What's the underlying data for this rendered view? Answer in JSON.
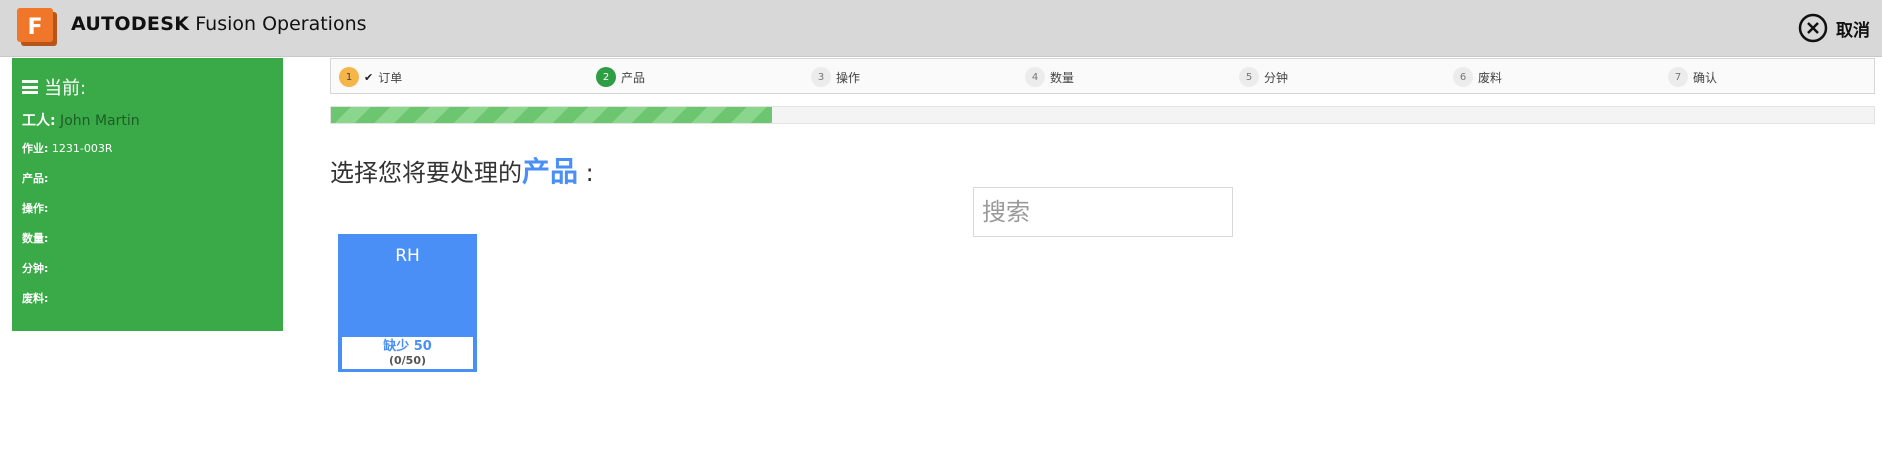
{
  "header": {
    "logo_letter": "F",
    "brand_bold": "AUTODESK",
    "brand_rest": " Fusion Operations",
    "cancel_label": "取消"
  },
  "sidebar": {
    "title": "当前:",
    "worker_label": "工人:",
    "worker_value": " John Martin",
    "fields": [
      {
        "label": "作业:",
        "value": " 1231-003R"
      },
      {
        "label": "产品:",
        "value": ""
      },
      {
        "label": "操作:",
        "value": ""
      },
      {
        "label": "数量:",
        "value": ""
      },
      {
        "label": "分钟:",
        "value": ""
      },
      {
        "label": "废料:",
        "value": ""
      }
    ]
  },
  "steps": [
    {
      "num": "1",
      "label": "订单",
      "state": "done"
    },
    {
      "num": "2",
      "label": "产品",
      "state": "active"
    },
    {
      "num": "3",
      "label": "操作",
      "state": "pending"
    },
    {
      "num": "4",
      "label": "数量",
      "state": "pending"
    },
    {
      "num": "5",
      "label": "分钟",
      "state": "pending"
    },
    {
      "num": "6",
      "label": "废料",
      "state": "pending"
    },
    {
      "num": "7",
      "label": "确认",
      "state": "pending"
    }
  ],
  "progress": {
    "fraction": 0.286
  },
  "prompt": {
    "prefix": "选择您将要处理的",
    "highlight": "产品",
    "suffix": " :"
  },
  "search": {
    "placeholder": "搜索"
  },
  "products": [
    {
      "name": "RH",
      "status": "缺少 50",
      "count": "(0/50)"
    }
  ],
  "colors": {
    "sidebar_green": "#3aaa48",
    "accent_blue": "#4a8ff5",
    "step_done": "#f5b548",
    "step_active": "#2e9e44",
    "progress_green": "#6cc56f"
  }
}
